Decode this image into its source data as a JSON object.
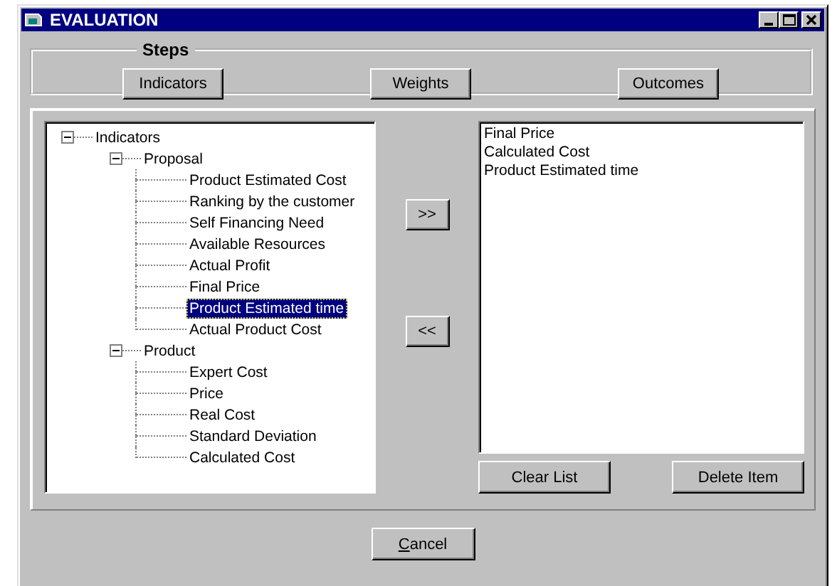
{
  "window": {
    "title": "EVALUATION"
  },
  "steps": {
    "label": "Steps",
    "buttons": [
      "Indicators",
      "Weights",
      "Outcomes"
    ]
  },
  "tree": [
    {
      "label": "Indicators",
      "expanded": true,
      "selected": false,
      "children": [
        {
          "label": "Proposal",
          "expanded": true,
          "selected": false,
          "children": [
            {
              "label": "Product Estimated Cost",
              "selected": false
            },
            {
              "label": "Ranking by the customer",
              "selected": false
            },
            {
              "label": "Self Financing Need",
              "selected": false
            },
            {
              "label": "Available Resources",
              "selected": false
            },
            {
              "label": "Actual Profit",
              "selected": false
            },
            {
              "label": "Final Price",
              "selected": false
            },
            {
              "label": "Product Estimated time",
              "selected": true
            },
            {
              "label": "Actual Product Cost",
              "selected": false
            }
          ]
        },
        {
          "label": "Product",
          "expanded": true,
          "selected": false,
          "children": [
            {
              "label": "Expert Cost",
              "selected": false
            },
            {
              "label": "Price",
              "selected": false
            },
            {
              "label": "Real Cost",
              "selected": false
            },
            {
              "label": "Standard Deviation",
              "selected": false
            },
            {
              "label": "Calculated Cost",
              "selected": false
            }
          ]
        }
      ]
    }
  ],
  "add_button": ">>",
  "remove_button": "<<",
  "selected_list": [
    "Final Price",
    "Calculated Cost",
    "Product Estimated time"
  ],
  "list_buttons": [
    "Clear List",
    "Delete Item"
  ],
  "cancel_button": {
    "label": "Cancel",
    "access_key_underlined": true
  }
}
